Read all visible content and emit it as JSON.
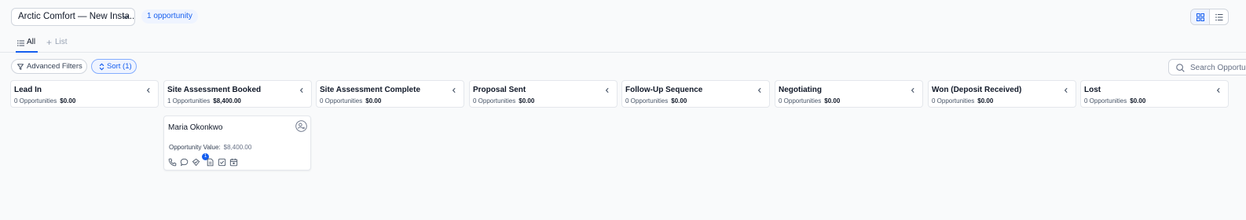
{
  "header": {
    "pipeline_name": "Arctic Comfort — New Insta...",
    "opportunity_count": "1 opportunity"
  },
  "tabs": [
    {
      "label": "All"
    },
    {
      "label": "List"
    }
  ],
  "toolbar": {
    "advanced_filters_label": "Advanced Filters",
    "sort_label": "Sort (1)",
    "search_placeholder": "Search Opportunities"
  },
  "columns": [
    {
      "title": "Lead In",
      "count": "0 Opportunities",
      "total": "$0.00"
    },
    {
      "title": "Site Assessment Booked",
      "count": "1 Opportunities",
      "total": "$8,400.00"
    },
    {
      "title": "Site Assessment Complete",
      "count": "0 Opportunities",
      "total": "$0.00"
    },
    {
      "title": "Proposal Sent",
      "count": "0 Opportunities",
      "total": "$0.00"
    },
    {
      "title": "Follow-Up Sequence",
      "count": "0 Opportunities",
      "total": "$0.00"
    },
    {
      "title": "Negotiating",
      "count": "0 Opportunities",
      "total": "$0.00"
    },
    {
      "title": "Won (Deposit Received)",
      "count": "0 Opportunities",
      "total": "$0.00"
    },
    {
      "title": "Lost",
      "count": "0 Opportunities",
      "total": "$0.00"
    }
  ],
  "card": {
    "contact_name": "Maria Okonkwo",
    "value_label": "Opportunity Value:",
    "value": "$8,400.00",
    "task_count": "1",
    "actions": [
      "phone-icon",
      "message-icon",
      "task-icon",
      "note-icon",
      "checklist-icon",
      "calendar-icon"
    ]
  },
  "colors": {
    "accent": "#155eef",
    "accent_light": "#eff4ff",
    "border": "#e4e7ec",
    "background": "#f9fafb"
  }
}
